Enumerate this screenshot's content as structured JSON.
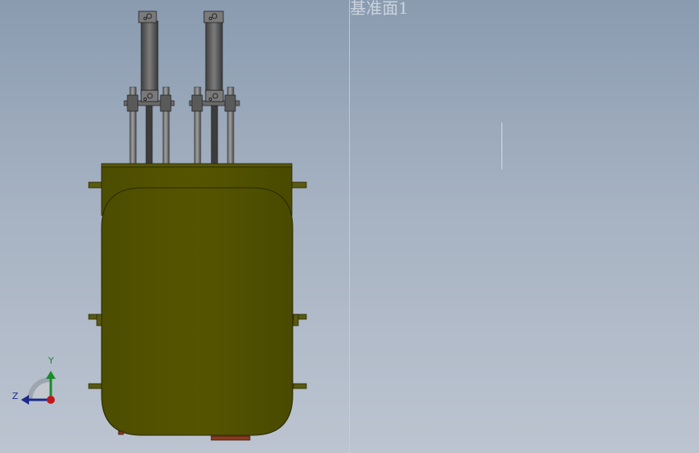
{
  "viewport": {
    "plane_label": "基准面1",
    "background_top": "#8a9bb0",
    "background_bottom": "#bcc4d0"
  },
  "model": {
    "body_color": "#4e4e00",
    "body_edge_color": "#3a3a00",
    "rod_color": "#7a7a7a",
    "bracket_color": "#5a5a5a",
    "foot_color": "#8a3a1a"
  },
  "triad": {
    "y_label": "Y",
    "z_label": "Z",
    "y_color": "#1a8a2a",
    "z_color": "#1a2a8a",
    "x_color": "#c01818"
  }
}
